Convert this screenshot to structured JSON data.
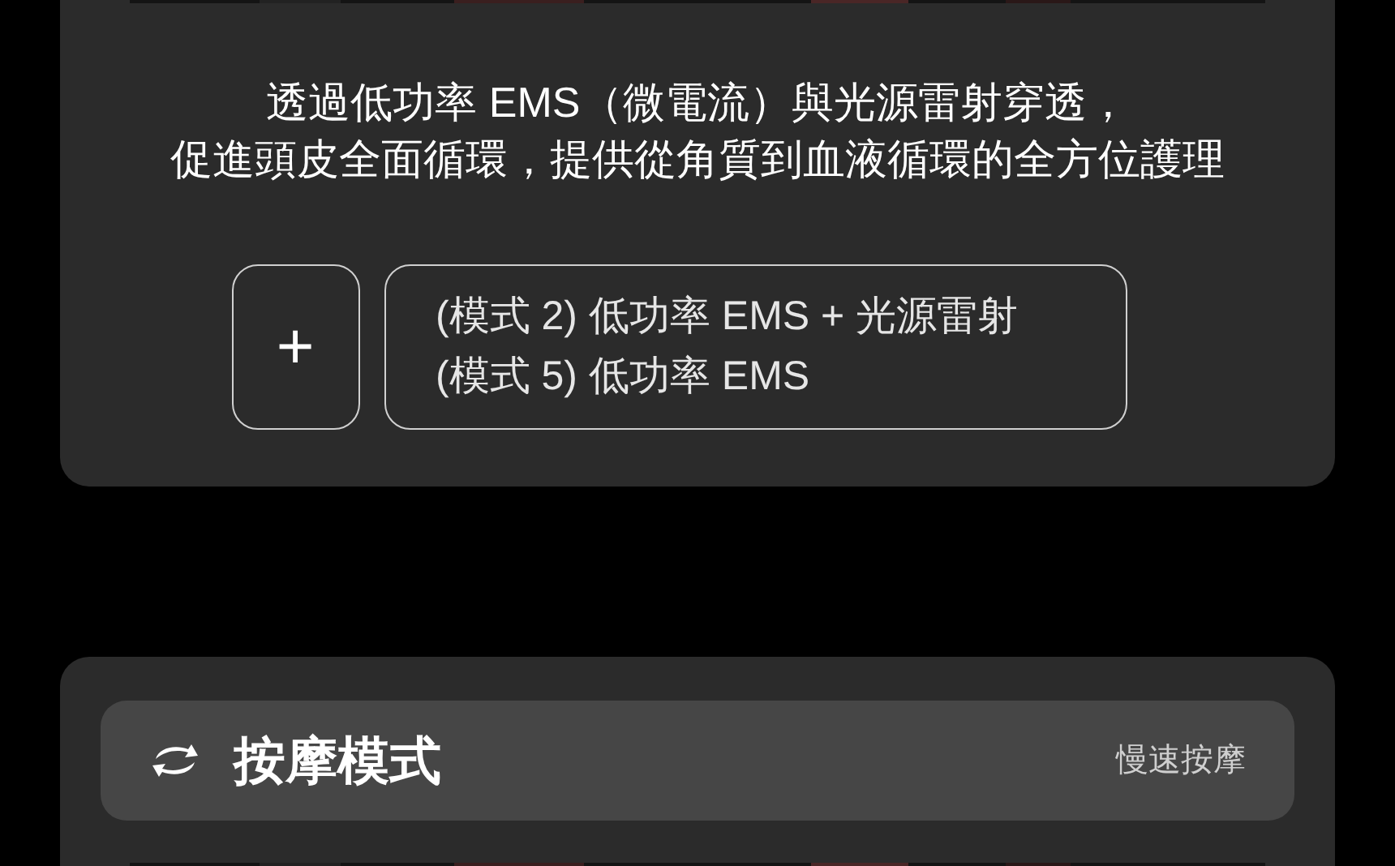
{
  "feature_card": {
    "description": [
      "透過低功率 EMS（微電流）與光源雷射穿透，",
      "促進頭皮全面循環，提供從角質到血液循環的全方位護理"
    ],
    "add_button": "+",
    "modes": [
      "(模式 2) 低功率 EMS + 光源雷射",
      "(模式 5) 低功率 EMS"
    ]
  },
  "massage_card": {
    "title": "按摩模式",
    "value": "慢速按摩"
  }
}
